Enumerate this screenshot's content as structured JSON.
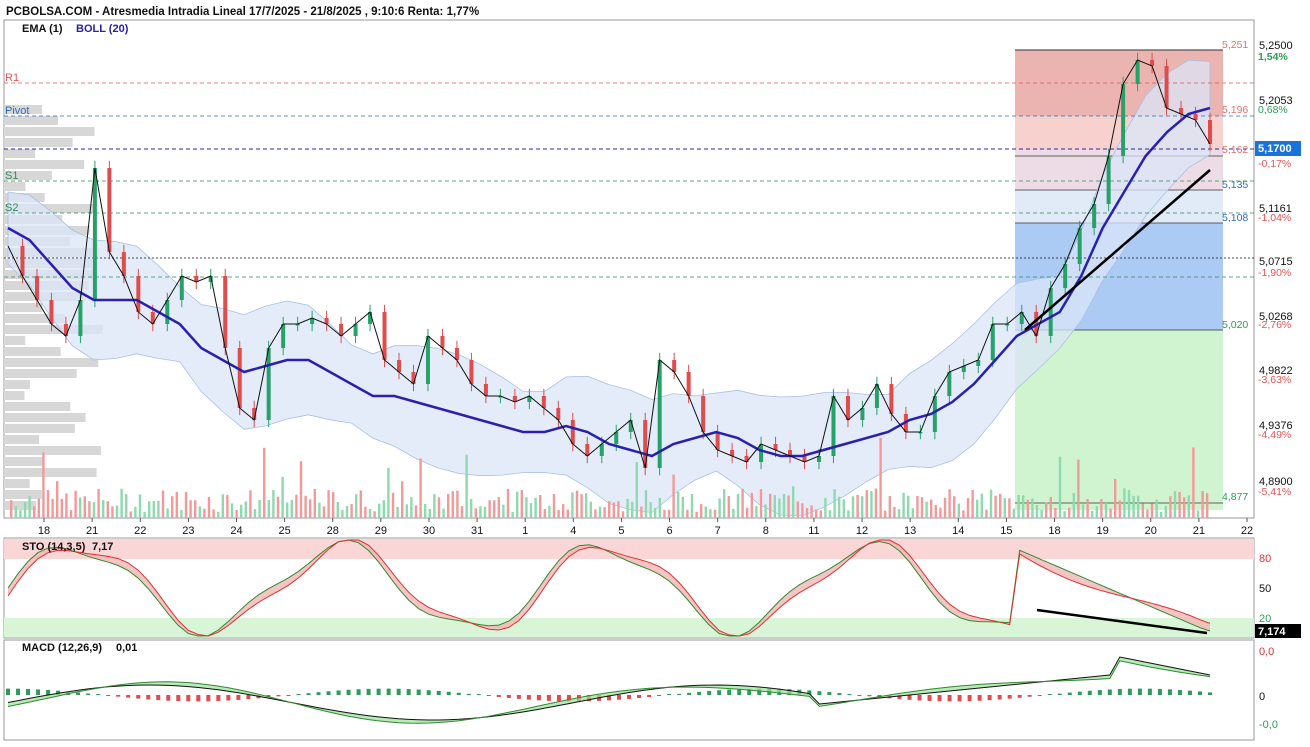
{
  "header": {
    "title": "PCBOLSA.COM - Atresmedia Intradia Lineal 17/7/2025 - 21/8/2025 , 9:10:6 Renta: 1,77%",
    "ema_label": "EMA (1)",
    "boll_label": "BOLL (20)"
  },
  "pivots": {
    "r1": "R1",
    "pivot": "Pivot",
    "s1": "S1",
    "s2": "S2"
  },
  "price_axis": {
    "ticks": [
      "5,2500",
      "5,2053",
      "5,1161",
      "5,0715",
      "5,0268",
      "4,9822",
      "4,9376",
      "4,8900"
    ],
    "current": "5,1700"
  },
  "fib_levels": [
    {
      "price": "5,251",
      "pct": "1,54%"
    },
    {
      "price": "5,196",
      "pct": "0,68%"
    },
    {
      "price": "5,162",
      "pct": "-0,17%"
    },
    {
      "price": "5,135",
      "pct": ""
    },
    {
      "price": "5,108",
      "pct": "-1,04%"
    },
    {
      "price": "",
      "pct": "-1,90%"
    },
    {
      "price": "5,020",
      "pct": "-2,76%"
    },
    {
      "price": "",
      "pct": "-3,63%"
    },
    {
      "price": "",
      "pct": "-4,49%"
    },
    {
      "price": "4,877",
      "pct": "-5,41%"
    }
  ],
  "x_axis": [
    "18",
    "21",
    "22",
    "23",
    "24",
    "25",
    "28",
    "29",
    "30",
    "31",
    "1",
    "4",
    "5",
    "6",
    "7",
    "8",
    "11",
    "12",
    "13",
    "14",
    "15",
    "18",
    "19",
    "20",
    "21",
    "22"
  ],
  "sto": {
    "label": "STO (14,3,5)",
    "value": "7,17",
    "ticks": [
      "80",
      "50",
      "20"
    ],
    "current": "7,174"
  },
  "macd": {
    "label": "MACD (12,26,9)",
    "value": "0,01",
    "ticks": [
      "0,0",
      "0",
      "-0,0"
    ]
  },
  "colors": {
    "up": "#26a269",
    "down": "#e04b4b",
    "boll_fill": "#dfe8f8",
    "ema": "#2a20b0",
    "current_price_bg": "#1a73d8"
  },
  "chart_data": {
    "type": "candlestick",
    "title": "PCBOLSA.COM - Atresmedia Intradia Lineal 17/7/2025 - 21/8/2025 , 9:10:6 Renta: 1,77%",
    "ylim": [
      4.865,
      5.265
    ],
    "current_price": 5.17,
    "x_labels": [
      "18",
      "21",
      "22",
      "23",
      "24",
      "25",
      "28",
      "29",
      "30",
      "31",
      "1",
      "4",
      "5",
      "6",
      "7",
      "8",
      "11",
      "12",
      "13",
      "14",
      "15",
      "18",
      "19",
      "20",
      "21",
      "22"
    ],
    "close_series": [
      5.085,
      5.06,
      5.04,
      5.02,
      5.01,
      5.04,
      5.15,
      5.08,
      5.06,
      5.03,
      5.02,
      5.04,
      5.06,
      5.055,
      5.06,
      5.0,
      4.95,
      4.94,
      5.0,
      5.02,
      5.02,
      5.025,
      5.02,
      5.01,
      5.02,
      5.03,
      4.99,
      4.98,
      4.97,
      5.01,
      5.0,
      4.99,
      4.97,
      4.96,
      4.96,
      4.955,
      4.96,
      4.95,
      4.94,
      4.92,
      4.91,
      4.92,
      4.93,
      4.94,
      4.9,
      4.99,
      4.98,
      4.96,
      4.93,
      4.915,
      4.91,
      4.905,
      4.92,
      4.915,
      4.91,
      4.905,
      4.91,
      4.96,
      4.94,
      4.95,
      4.97,
      4.945,
      4.93,
      4.93,
      4.96,
      4.98,
      4.985,
      4.99,
      5.02,
      5.02,
      5.03,
      5.01,
      5.05,
      5.07,
      5.1,
      5.12,
      5.16,
      5.22,
      5.24,
      5.235,
      5.2,
      5.195,
      5.19,
      5.17
    ],
    "ema_series": [
      5.1,
      5.09,
      5.07,
      5.05,
      5.04,
      5.04,
      5.04,
      5.03,
      5.02,
      5.0,
      4.99,
      4.98,
      4.985,
      4.99,
      4.99,
      4.98,
      4.97,
      4.96,
      4.96,
      4.955,
      4.95,
      4.945,
      4.94,
      4.935,
      4.93,
      4.93,
      4.935,
      4.93,
      4.92,
      4.915,
      4.91,
      4.92,
      4.925,
      4.93,
      4.925,
      4.915,
      4.91,
      4.91,
      4.915,
      4.92,
      4.925,
      4.93,
      4.94,
      4.945,
      4.955,
      4.97,
      4.99,
      5.01,
      5.02,
      5.03,
      5.06,
      5.1,
      5.13,
      5.16,
      5.18,
      5.195,
      5.2
    ],
    "fibonacci": [
      5.251,
      5.196,
      5.162,
      5.135,
      5.108,
      5.02,
      4.877
    ],
    "pivots": {
      "R1": 5.222,
      "Pivot": 5.196,
      "S1": 5.141,
      "S2": 5.114
    },
    "sto": {
      "k": 7.17,
      "levels": [
        80,
        50,
        20
      ]
    },
    "macd": {
      "value": 0.01
    }
  }
}
